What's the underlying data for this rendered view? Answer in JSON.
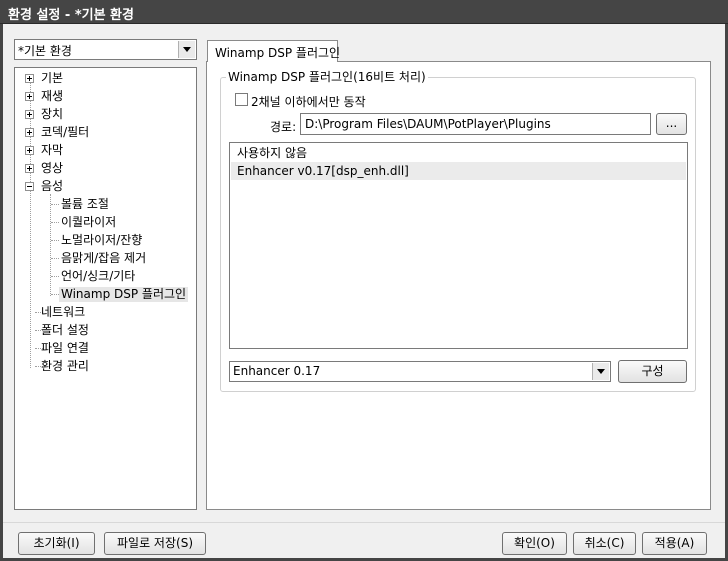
{
  "window": {
    "title": "환경 설정 - *기본 환경"
  },
  "profile": {
    "selected": "*기본 환경"
  },
  "tree": {
    "items": [
      {
        "label": "기본",
        "expander": "plus"
      },
      {
        "label": "재생",
        "expander": "plus"
      },
      {
        "label": "장치",
        "expander": "plus"
      },
      {
        "label": "코덱/필터",
        "expander": "plus"
      },
      {
        "label": "자막",
        "expander": "plus"
      },
      {
        "label": "영상",
        "expander": "plus"
      },
      {
        "label": "음성",
        "expander": "minus"
      },
      {
        "label": "볼륨 조절"
      },
      {
        "label": "이퀄라이저"
      },
      {
        "label": "노멀라이저/잔향"
      },
      {
        "label": "음맑게/잡음 제거"
      },
      {
        "label": "언어/싱크/기타"
      },
      {
        "label": "Winamp DSP 플러그인",
        "selected": true
      },
      {
        "label": "네트워크"
      },
      {
        "label": "폴더 설정"
      },
      {
        "label": "파일 연결"
      },
      {
        "label": "환경 관리"
      }
    ]
  },
  "tab": {
    "label": "Winamp DSP 플러그인"
  },
  "group": {
    "title": "Winamp DSP 플러그인(16비트 처리)",
    "checkbox_label": "2채널 이하에서만 동작",
    "checkbox_checked": false,
    "path_label": "경로:",
    "path_value": "D:\\Program Files\\DAUM\\PotPlayer\\Plugins",
    "browse_label": "...",
    "plugins": [
      {
        "label": "사용하지 않음"
      },
      {
        "label": "Enhancer v0.17[dsp_enh.dll]",
        "highlighted": true
      }
    ],
    "preset_selected": "Enhancer 0.17",
    "configure_label": "구성"
  },
  "footer": {
    "reset_label": "초기화(I)",
    "save_file_label": "파일로 저장(S)",
    "ok_label": "확인(O)",
    "cancel_label": "취소(C)",
    "apply_label": "적용(A)"
  },
  "colors": {
    "titlebar": "#454545",
    "title_text": "#ffffff",
    "panel_bg": "#f0f0f0",
    "selection": "#e6e6e6"
  }
}
